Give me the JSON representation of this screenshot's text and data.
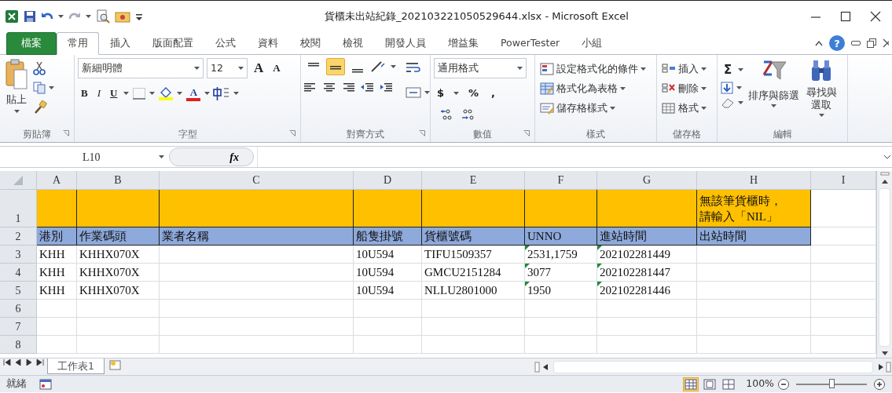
{
  "window": {
    "title": "貨櫃未出站紀錄_202103221050529644.xlsx - Microsoft Excel"
  },
  "tabs": [
    {
      "label": "檔案",
      "kind": "file",
      "selected": false
    },
    {
      "label": "常用",
      "kind": "tab",
      "selected": true
    },
    {
      "label": "插入",
      "kind": "tab",
      "selected": false
    },
    {
      "label": "版面配置",
      "kind": "tab",
      "selected": false
    },
    {
      "label": "公式",
      "kind": "tab",
      "selected": false
    },
    {
      "label": "資料",
      "kind": "tab",
      "selected": false
    },
    {
      "label": "校閱",
      "kind": "tab",
      "selected": false
    },
    {
      "label": "檢視",
      "kind": "tab",
      "selected": false
    },
    {
      "label": "開發人員",
      "kind": "tab",
      "selected": false
    },
    {
      "label": "增益集",
      "kind": "tab",
      "selected": false
    },
    {
      "label": "PowerTester",
      "kind": "tab",
      "selected": false
    },
    {
      "label": "小組",
      "kind": "tab",
      "selected": false
    }
  ],
  "help": "?",
  "ribbon": {
    "clipboard": {
      "label": "剪貼簿",
      "paste": "貼上"
    },
    "font": {
      "label": "字型",
      "font_name": "新細明體",
      "font_size": "12",
      "grow": "A",
      "shrink": "A",
      "bold": "B",
      "italic": "I",
      "underline": "U",
      "font_color": "A"
    },
    "alignment": {
      "label": "對齊方式",
      "vertical": [
        {
          "selected": false
        },
        {
          "selected": true
        },
        {
          "selected": false
        }
      ]
    },
    "number": {
      "label": "數值",
      "format": "通用格式",
      "currency": "$",
      "percent": "%",
      "comma": ","
    },
    "styles": {
      "label": "樣式",
      "items": [
        "設定格式化的條件",
        "格式化為表格",
        "儲存格樣式"
      ]
    },
    "cells": {
      "label": "儲存格",
      "items": [
        "插入",
        "刪除",
        "格式"
      ]
    },
    "editing": {
      "label": "編輯",
      "autosum": "Σ",
      "sort": "排序與篩選",
      "find": "尋找與選取"
    }
  },
  "formula_bar": {
    "name_box": "L10",
    "function_label": "fx"
  },
  "columns": [
    "A",
    "B",
    "C",
    "D",
    "E",
    "F",
    "G",
    "H",
    "I"
  ],
  "rows": [
    {
      "number": "1",
      "color": "#ffc000",
      "cells": [
        {},
        {},
        {},
        {},
        {},
        {},
        {},
        {
          "text": "無該筆貨櫃時，請輸入「NIL」"
        }
      ]
    },
    {
      "number": "2",
      "color": "#8ea9db",
      "cells": [
        {
          "text": "港別"
        },
        {
          "text": "作業碼頭"
        },
        {
          "text": "業者名稱"
        },
        {
          "text": "船隻掛號"
        },
        {
          "text": "貨櫃號碼"
        },
        {
          "text": "UNNO"
        },
        {
          "text": "進站時間"
        },
        {
          "text": "出站時間"
        }
      ]
    },
    {
      "number": "3",
      "cells": [
        {
          "text": "KHH",
          "flagged": false
        },
        {
          "text": "KHHX070X",
          "flagged": false
        },
        {},
        {
          "text": "10U594",
          "flagged": false
        },
        {
          "text": "TIFU1509357",
          "flagged": false
        },
        {
          "text": "2531,1759",
          "flagged": true
        },
        {
          "text": "202102281449",
          "flagged": true
        },
        {}
      ]
    },
    {
      "number": "4",
      "cells": [
        {
          "text": "KHH",
          "flagged": false
        },
        {
          "text": "KHHX070X",
          "flagged": false
        },
        {},
        {
          "text": "10U594",
          "flagged": false
        },
        {
          "text": "GMCU2151284",
          "flagged": false
        },
        {
          "text": "3077",
          "flagged": true
        },
        {
          "text": "202102281447",
          "flagged": true
        },
        {}
      ]
    },
    {
      "number": "5",
      "cells": [
        {
          "text": "KHH",
          "flagged": false
        },
        {
          "text": "KHHX070X",
          "flagged": false
        },
        {},
        {
          "text": "10U594",
          "flagged": false
        },
        {
          "text": "NLLU2801000",
          "flagged": false
        },
        {
          "text": "1950",
          "flagged": true
        },
        {
          "text": "202102281446",
          "flagged": true
        },
        {}
      ]
    },
    {
      "number": "6",
      "cells": []
    },
    {
      "number": "7",
      "cells": []
    },
    {
      "number": "8",
      "cells": []
    }
  ],
  "sheet_tabs": [
    {
      "label": "工作表1",
      "selected": true
    }
  ],
  "status_bar": {
    "status": "就緒",
    "views": [
      {
        "selected": true
      },
      {
        "selected": false
      },
      {
        "selected": false
      }
    ],
    "zoom": "100%",
    "zoom_slider": {
      "level": 0.5
    }
  }
}
